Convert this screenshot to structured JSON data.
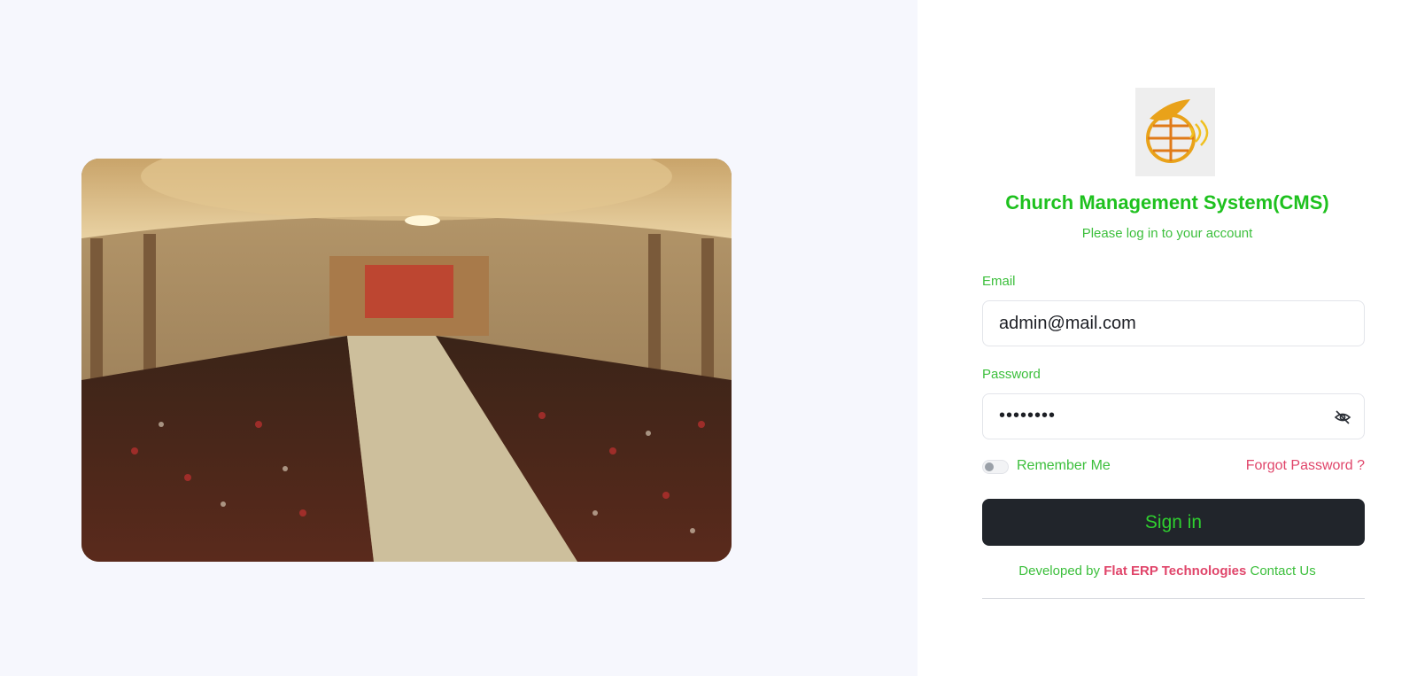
{
  "hero": {
    "image": "church-congregation-photo"
  },
  "header": {
    "app_title": "Church Management System(CMS)",
    "subtitle": "Please log in to your account"
  },
  "form": {
    "email_label": "Email",
    "email_value": "admin@mail.com",
    "password_label": "Password",
    "password_masked": "••••••••",
    "remember_label": "Remember Me",
    "remember_checked": false,
    "forgot_label": "Forgot Password ?",
    "signin_label": "Sign in"
  },
  "footer": {
    "developed_by": "Developed by",
    "company": "Flat ERP Technologies",
    "contact": "Contact Us"
  },
  "colors": {
    "accent_green": "#1ec11e",
    "link_pink": "#e0456a",
    "button_dark": "#21252b",
    "left_bg": "#f6f7fd"
  },
  "icons": {
    "logo": "globe-dove-broadcast-logo",
    "password_toggle": "eye-slash-icon"
  }
}
